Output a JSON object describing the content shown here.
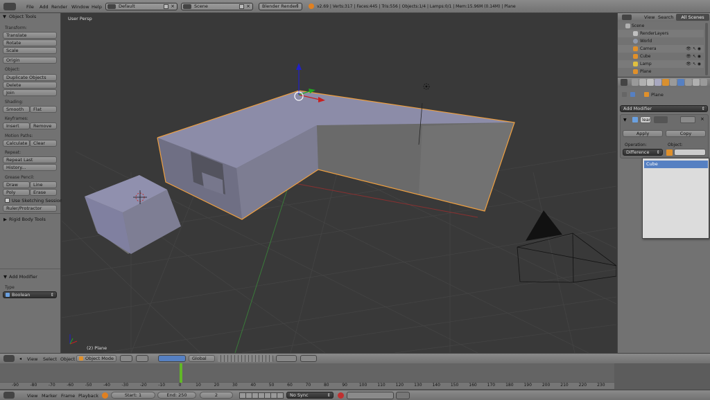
{
  "topbar": {
    "menus": [
      "File",
      "Add",
      "Render",
      "Window",
      "Help"
    ],
    "layout_field": "Default",
    "scene_field": "Scene",
    "engine": "Blender Render",
    "stats": "v2.69 | Verts:317 | Faces:445 | Tris:556 | Objects:1/4 | Lamps:0/1 | Mem:15.96M (0.14M) | Plane"
  },
  "toolshelf": {
    "title": "Object Tools",
    "transform_label": "Transform:",
    "translate": "Translate",
    "rotate": "Rotate",
    "scale": "Scale",
    "origin": "Origin",
    "object_label": "Object:",
    "duplicate": "Duplicate Objects",
    "delete": "Delete",
    "join": "Join",
    "shading_label": "Shading:",
    "smooth": "Smooth",
    "flat": "Flat",
    "keyframes_label": "Keyframes:",
    "insert": "Insert",
    "remove": "Remove",
    "motion_label": "Motion Paths:",
    "calculate": "Calculate",
    "clear": "Clear",
    "repeat_label": "Repeat:",
    "repeat_last": "Repeat Last",
    "history": "History...",
    "grease_label": "Grease Pencil:",
    "draw": "Draw",
    "line": "Line",
    "poly": "Poly",
    "erase": "Erase",
    "sketching": "Use Sketching Sessions",
    "ruler": "Ruler/Protractor",
    "rigid_body": "Rigid Body Tools",
    "add_modifier": "Add Modifier",
    "type_label": "Type",
    "type_value": "Boolean"
  },
  "viewport": {
    "view_name": "User Persp",
    "object_label": "(2) Plane"
  },
  "outliner": {
    "tabs": [
      "View",
      "Search",
      "All Scenes"
    ],
    "items": [
      "Scene",
      "RenderLayers",
      "World",
      "Camera",
      "Cube",
      "Lamp",
      "Plane"
    ]
  },
  "properties": {
    "breadcrumb": "Plane",
    "add_modifier": "Add Modifier",
    "modifier_name": "lean",
    "apply": "Apply",
    "copy": "Copy",
    "operation_label": "Operation:",
    "object_label": "Object:",
    "operation_value": "Difference",
    "dropdown_item": "Cube"
  },
  "view3d_header": {
    "menus": [
      "View",
      "Select",
      "Object"
    ],
    "mode": "Object Mode",
    "orientation": "Global"
  },
  "timeline": {
    "ticks": [
      "-90",
      "-80",
      "-70",
      "-60",
      "-50",
      "-40",
      "-30",
      "-20",
      "-10",
      "0",
      "10",
      "20",
      "30",
      "40",
      "50",
      "60",
      "70",
      "80",
      "90",
      "100",
      "110",
      "120",
      "130",
      "140",
      "150",
      "160",
      "170",
      "180",
      "190",
      "200",
      "210",
      "220",
      "230"
    ],
    "current_frame": 2,
    "menus": [
      "View",
      "Marker",
      "Frame",
      "Playback"
    ],
    "start": "Start: 1",
    "end": "End: 250",
    "frame": "2",
    "sync": "No Sync"
  },
  "colors": {
    "selected_outline": "#f0a040",
    "mesh_face": "#8a8aa8",
    "playhead": "#60c020",
    "dropdown_highlight": "#5680c2"
  }
}
